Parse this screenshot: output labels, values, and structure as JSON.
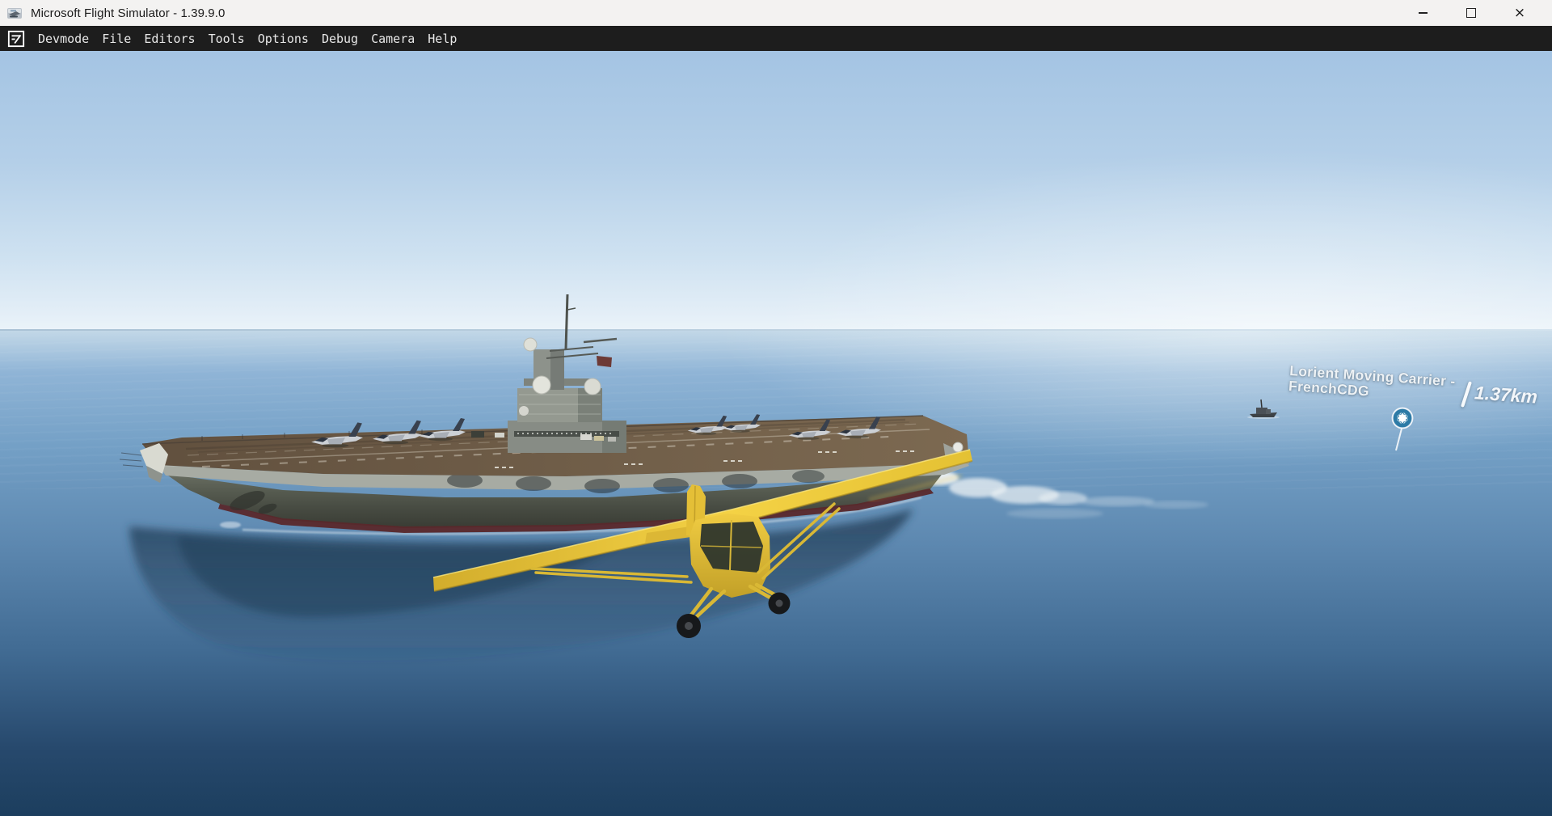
{
  "window": {
    "title": "Microsoft Flight Simulator - 1.39.9.0",
    "controls": {
      "close_glyph": "×"
    }
  },
  "menu": {
    "items": [
      {
        "label": "Devmode"
      },
      {
        "label": "File"
      },
      {
        "label": "Editors"
      },
      {
        "label": "Tools"
      },
      {
        "label": "Options"
      },
      {
        "label": "Debug"
      },
      {
        "label": "Camera"
      },
      {
        "label": "Help"
      }
    ]
  },
  "scene": {
    "poi_label": {
      "line1": "Lorient Moving Carrier -",
      "line2": "FrenchCDG",
      "distance": "1.37km"
    },
    "icons": {
      "app_icon": "msfs-logo",
      "devmode_icon": "document-edit",
      "minimize_icon": "minimize-dash",
      "maximize_icon": "maximize-square",
      "close_icon": "close-cross",
      "waypoint_icon": "poi-circle-gear"
    },
    "colors": {
      "sky_top": "#a4c4e3",
      "sky_horizon": "#eaf3f9",
      "sea_shallow": "#c4d9e8",
      "sea_deep": "#1c3e5e",
      "marker_ring": "#2d7ba6",
      "aircraft_yellow": "#eec83e",
      "deck_brown": "#6e5947",
      "hull_gray": "#565b50",
      "waterline_red": "#5a282b",
      "menubar_bg": "#1d1d1d",
      "titlebar_bg": "#f3f2f1"
    }
  }
}
